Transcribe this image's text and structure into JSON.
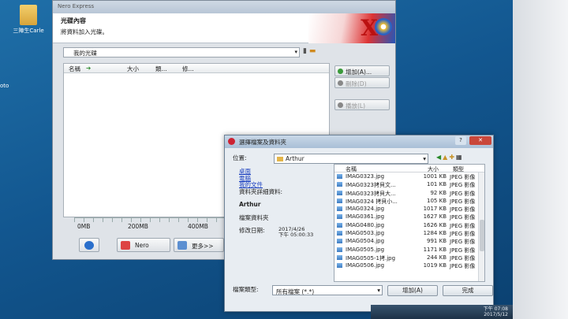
{
  "desktop": {
    "icon_label": "三陣生Carle",
    "fragment": "oto"
  },
  "nero": {
    "title": "Nero Express",
    "header_title": "光碟內容",
    "header_subtitle": "將資料加入光碟。",
    "drive_label": "我的光碟",
    "columns": {
      "name": "名稱",
      "size": "大小",
      "type": "類...",
      "modified": "修..."
    },
    "buttons": {
      "add": "增加(A)...",
      "delete": "刪除(D)",
      "play": "播放(L)"
    },
    "capacity_labels": [
      "0MB",
      "200MB",
      "400MB"
    ],
    "bottom": {
      "nero": "Nero",
      "more": "更多>>"
    }
  },
  "dialog": {
    "title": "選擇檔案及資料夾",
    "location_label": "位置:",
    "location_value": "Arthur",
    "places": {
      "desktop": "桌面",
      "computer": "電腦",
      "documents": "我的文件",
      "details_title": "資料夾詳細資料:",
      "folder_name": "Arthur",
      "folder_type": "檔案資料夾",
      "modified_label": "修改日期:",
      "modified_date": "2017/4/26",
      "modified_time": "下午 05:00:33"
    },
    "file_columns": {
      "name": "名稱",
      "size": "大小",
      "type": "類型"
    },
    "files": [
      {
        "name": "IMAG0323.jpg",
        "size": "1001 KB",
        "type": "JPEG 影像"
      },
      {
        "name": "IMAG0323拷貝文...",
        "size": "101 KB",
        "type": "JPEG 影像"
      },
      {
        "name": "IMAG0323拷貝大...",
        "size": "92 KB",
        "type": "JPEG 影像"
      },
      {
        "name": "IMAG0324 拷貝小...",
        "size": "105 KB",
        "type": "JPEG 影像"
      },
      {
        "name": "IMAG0324.jpg",
        "size": "1017 KB",
        "type": "JPEG 影像"
      },
      {
        "name": "IMAG0361.jpg",
        "size": "1627 KB",
        "type": "JPEG 影像"
      },
      {
        "name": "IMAG0480.jpg",
        "size": "1626 KB",
        "type": "JPEG 影像"
      },
      {
        "name": "IMAG0503.jpg",
        "size": "1284 KB",
        "type": "JPEG 影像"
      },
      {
        "name": "IMAG0504.jpg",
        "size": "991 KB",
        "type": "JPEG 影像"
      },
      {
        "name": "IMAG0505.jpg",
        "size": "1171 KB",
        "type": "JPEG 影像"
      },
      {
        "name": "IMAG0505-1拷.jpg",
        "size": "244 KB",
        "type": "JPEG 影像"
      },
      {
        "name": "IMAG0506.jpg",
        "size": "1019 KB",
        "type": "JPEG 影像"
      }
    ],
    "type_label": "檔案類型:",
    "type_value": "所有檔案 (*.*)",
    "add_button": "增加(A)",
    "close_button": "完成"
  },
  "taskbar": {
    "time": "下午 07:08",
    "date": "2017/5/12"
  },
  "colors": {
    "accent_red": "#c22222",
    "link_blue": "#1a3fbf"
  }
}
